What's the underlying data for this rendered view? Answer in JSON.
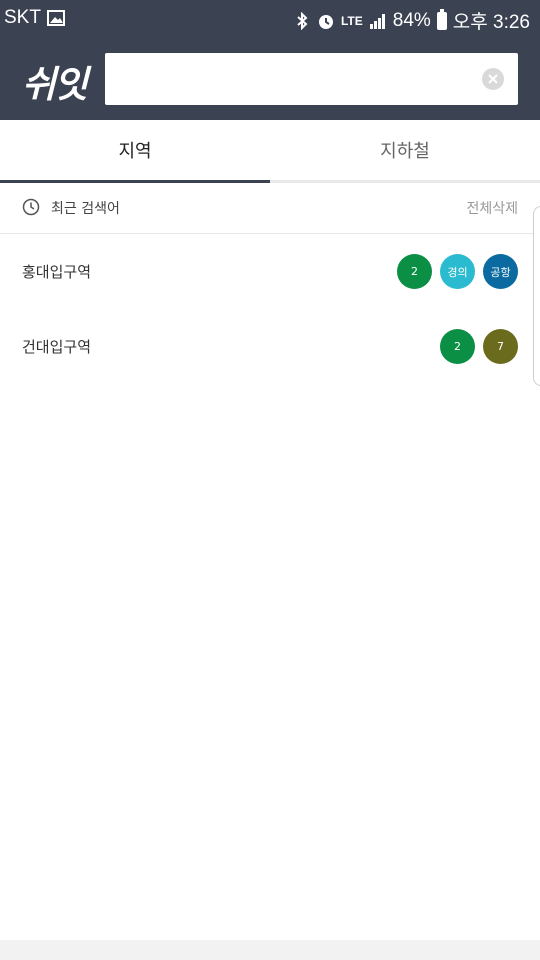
{
  "status_bar": {
    "carrier": "SKT",
    "network": "LTE",
    "battery": "84%",
    "time": "오후 3:26"
  },
  "header": {
    "logo": "쉬잇",
    "search": {
      "value": "",
      "placeholder": ""
    }
  },
  "tabs": [
    {
      "label": "지역",
      "active": true
    },
    {
      "label": "지하철",
      "active": false
    }
  ],
  "recent": {
    "title": "최근 검색어",
    "clear_all": "전체삭제",
    "items": [
      {
        "name": "홍대입구역",
        "lines": [
          {
            "label": "2",
            "color": "#0a8f45"
          },
          {
            "label": "경의",
            "color": "#2bbbd0"
          },
          {
            "label": "공항",
            "color": "#0b6aa0"
          }
        ]
      },
      {
        "name": "건대입구역",
        "lines": [
          {
            "label": "2",
            "color": "#0a8f45"
          },
          {
            "label": "7",
            "color": "#6b6b1e"
          }
        ]
      }
    ]
  },
  "colors": {
    "header_bg": "#3b4252",
    "tab_indicator": "#3b4252"
  }
}
